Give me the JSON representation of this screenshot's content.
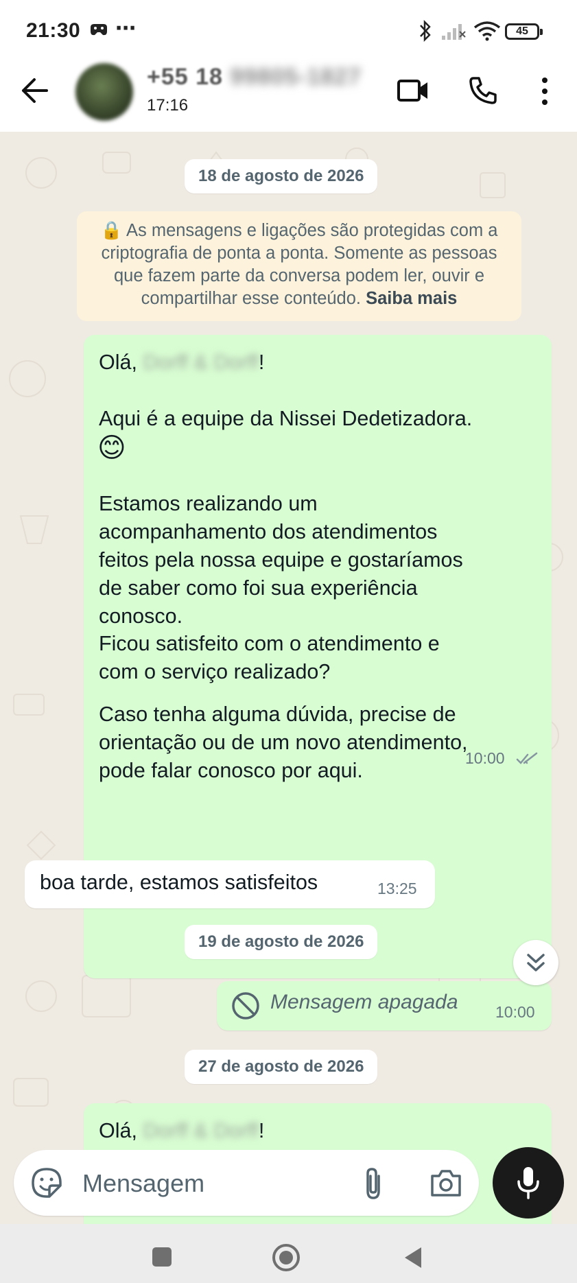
{
  "status_bar": {
    "time": "21:30",
    "battery": "45"
  },
  "header": {
    "contact_name": "+55 18",
    "contact_name_hidden": "99805-1827",
    "last_seen": "17:16"
  },
  "chat": {
    "dates": [
      "18 de agosto de 2026",
      "19 de agosto de 2026",
      "27 de agosto de 2026"
    ],
    "encryption_notice": {
      "text": "As mensagens e ligações são protegidas com a criptografia de ponta a ponta. Somente as pessoas que fazem parte da conversa podem ler, ouvir e compartilhar esse conteúdo.",
      "link": "Saiba mais"
    },
    "messages": [
      {
        "direction": "out",
        "greeting": "Olá,",
        "hidden_name": "Dorff & Dorff",
        "greeting_end": "!",
        "line1": "Aqui é a equipe da Nissei Dedetizadora.",
        "emoji": "😊",
        "para2": "Estamos realizando um\nacompanhamento dos atendimentos\nfeitos pela nossa equipe e gostaríamos\nde saber como foi sua experiência\nconosco.",
        "para3": "Ficou satisfeito com o atendimento e\ncom o serviço realizado?",
        "para4": "Caso tenha alguma dúvida, precise de\norientação ou de um novo atendimento,\npode falar conosco por aqui.",
        "time": "10:00"
      },
      {
        "direction": "in",
        "text": "boa tarde, estamos satisfeitos",
        "time": "13:25"
      },
      {
        "direction": "out",
        "text": "Mensagem apagada",
        "time": "10:00"
      },
      {
        "direction": "out",
        "greeting": "Olá,",
        "hidden_name": "Dorff & Dorff",
        "greeting_end": "!"
      }
    ]
  },
  "input": {
    "placeholder": "Mensagem"
  }
}
